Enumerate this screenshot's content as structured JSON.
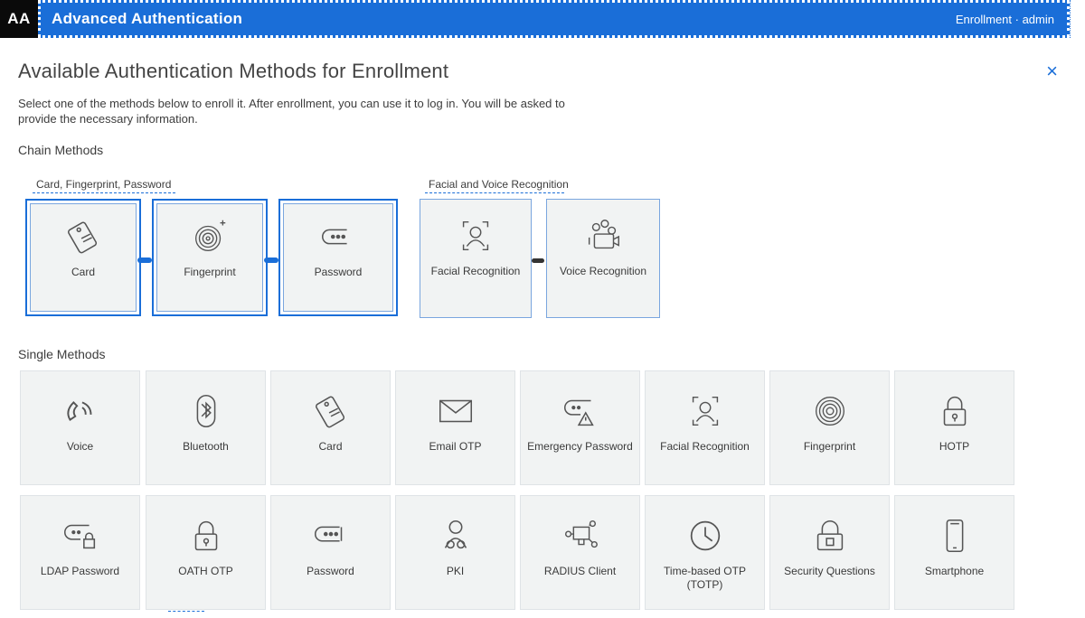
{
  "topbar": {
    "logo": "AA",
    "app_title": "Advanced Authentication",
    "user_link": "Enrollment · admin"
  },
  "header": {
    "title": "Available Authentication Methods for Enrollment",
    "close": "×",
    "description": "Select one of the methods below to enroll it. After enrollment, you can use it to log in. You will be asked to provide the necessary information."
  },
  "chain_section": {
    "label": "Chain Methods",
    "groups": [
      {
        "label": "Card, Fingerprint, Password"
      },
      {
        "label": "Facial and Voice Recognition"
      }
    ],
    "tiles": [
      {
        "label": "Card",
        "icon": "card-icon"
      },
      {
        "label": "Fingerprint",
        "icon": "fingerprint-icon"
      },
      {
        "label": "Password",
        "icon": "password-icon"
      },
      {
        "label": "Facial Recognition",
        "icon": "facial-recognition-icon"
      },
      {
        "label": "Voice Recognition",
        "icon": "voice-icon"
      }
    ]
  },
  "single_section": {
    "label": "Single Methods",
    "tiles": [
      {
        "label": "Voice",
        "icon": "voice-call-icon"
      },
      {
        "label": "Bluetooth",
        "icon": "bluetooth-icon"
      },
      {
        "label": "Card",
        "icon": "card-icon"
      },
      {
        "label": "Email OTP",
        "icon": "email-icon"
      },
      {
        "label": "Emergency Password",
        "icon": "emergency-password-icon"
      },
      {
        "label": "Facial Recognition",
        "icon": "face-icon"
      },
      {
        "label": "Fingerprint",
        "icon": "fingerprint-icon"
      },
      {
        "label": "HOTP",
        "icon": "lock-icon"
      },
      {
        "label": "LDAP Password",
        "icon": "ldap-password-icon"
      },
      {
        "label": "OATH OTP",
        "icon": "lock-icon"
      },
      {
        "label": "Password",
        "icon": "password-icon"
      },
      {
        "label": "PKI",
        "icon": "pki-user-icon"
      },
      {
        "label": "RADIUS Client",
        "icon": "radius-client-icon"
      },
      {
        "label": "Time-based OTP (TOTP)",
        "icon": "clock-icon"
      },
      {
        "label": "Security Questions",
        "icon": "security-lock-icon"
      },
      {
        "label": "Smartphone",
        "icon": "smartphone-icon"
      }
    ]
  },
  "colors": {
    "accent": "#1a6ed8",
    "tile_bg": "#f1f3f3"
  }
}
